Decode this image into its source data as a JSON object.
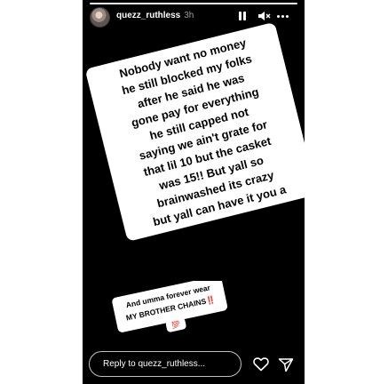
{
  "story": {
    "username": "quezz_ruthless",
    "time_ago": "3h",
    "text_lines": [
      "Nobody want no money",
      "he still blocked my folks",
      "after he said he was",
      "gone pay for everything",
      "he still capped not",
      "saying we ain't grate for",
      "that lil 10 but the casket",
      "was 15!! But yall so",
      "brainwashed its crazy",
      "but yall can have it you a"
    ],
    "caption_lines": [
      "And umma forever wear",
      "MY BROTHER CHAINS‼️",
      "💯"
    ],
    "reply_placeholder": "Reply to quezz_ruthless..."
  },
  "icons": {
    "pause": "pause-icon",
    "mute": "mute-icon",
    "more": "more-icon",
    "heart": "heart-icon",
    "send": "send-icon"
  },
  "colors": {
    "background": "#000000",
    "sticker_fill": "#ffffff",
    "sticker_text": "#000000",
    "caption_emoji": "#e0245e"
  }
}
